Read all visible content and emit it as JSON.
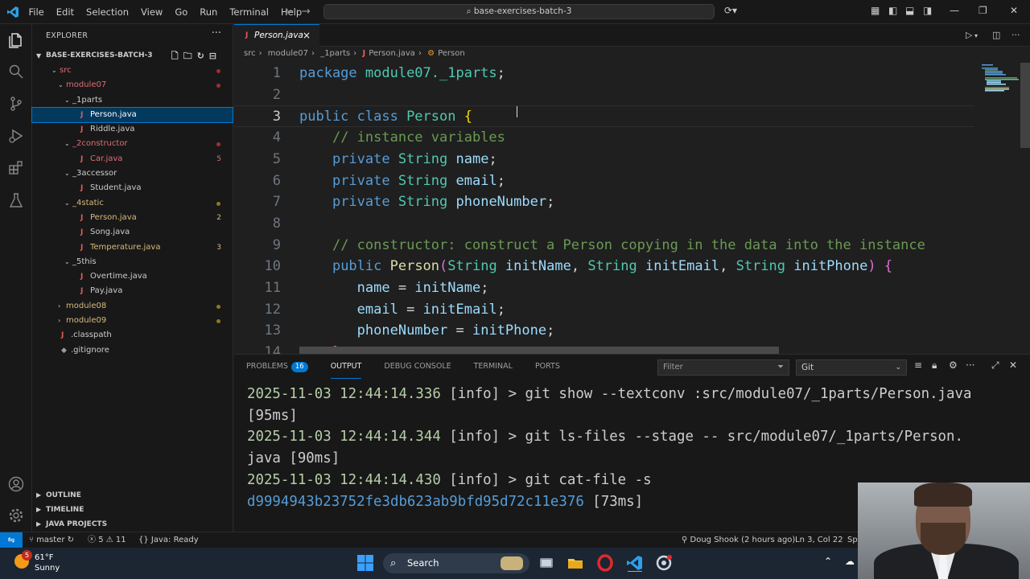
{
  "titlebar": {
    "menu": [
      "File",
      "Edit",
      "Selection",
      "View",
      "Go",
      "Run",
      "Terminal",
      "Help"
    ],
    "command_center": "base-exercises-batch-3"
  },
  "explorer": {
    "title": "EXPLORER",
    "root": "BASE-EXERCISES-BATCH-3",
    "tree": [
      {
        "label": "src",
        "kind": "folder",
        "open": true,
        "depth": 0,
        "color": "#e06c75",
        "dot": "#a03030"
      },
      {
        "label": "module07",
        "kind": "folder",
        "open": true,
        "depth": 1,
        "color": "#e06c75",
        "dot": "#a03030"
      },
      {
        "label": "_1parts",
        "kind": "folder",
        "open": true,
        "depth": 2,
        "color": "#cccccc"
      },
      {
        "label": "Person.java",
        "kind": "file",
        "depth": 3,
        "color": "#ffffff",
        "selected": true
      },
      {
        "label": "Riddle.java",
        "kind": "file",
        "depth": 3,
        "color": "#cccccc"
      },
      {
        "label": "_2constructor",
        "kind": "folder",
        "open": true,
        "depth": 2,
        "color": "#e06c75",
        "dot": "#a03030"
      },
      {
        "label": "Car.java",
        "kind": "file",
        "depth": 3,
        "color": "#e06c75",
        "badge": "5",
        "badge_color": "#e06c75"
      },
      {
        "label": "_3accessor",
        "kind": "folder",
        "open": true,
        "depth": 2,
        "color": "#cccccc"
      },
      {
        "label": "Student.java",
        "kind": "file",
        "depth": 3,
        "color": "#cccccc"
      },
      {
        "label": "_4static",
        "kind": "folder",
        "open": true,
        "depth": 2,
        "color": "#d7ba7d",
        "dot": "#8a7a20"
      },
      {
        "label": "Person.java",
        "kind": "file",
        "depth": 3,
        "color": "#d7ba7d",
        "badge": "2",
        "badge_color": "#d7ba7d"
      },
      {
        "label": "Song.java",
        "kind": "file",
        "depth": 3,
        "color": "#cccccc"
      },
      {
        "label": "Temperature.java",
        "kind": "file",
        "depth": 3,
        "color": "#d7ba7d",
        "badge": "3",
        "badge_color": "#d7ba7d"
      },
      {
        "label": "_5this",
        "kind": "folder",
        "open": true,
        "depth": 2,
        "color": "#cccccc"
      },
      {
        "label": "Overtime.java",
        "kind": "file",
        "depth": 3,
        "color": "#cccccc"
      },
      {
        "label": "Pay.java",
        "kind": "file",
        "depth": 3,
        "color": "#cccccc"
      },
      {
        "label": "module08",
        "kind": "folder",
        "open": false,
        "depth": 1,
        "color": "#d7ba7d",
        "dot": "#8a7a20"
      },
      {
        "label": "module09",
        "kind": "folder",
        "open": false,
        "depth": 1,
        "color": "#d7ba7d",
        "dot": "#8a7a20"
      },
      {
        "label": ".classpath",
        "kind": "file",
        "depth": 0,
        "color": "#cccccc"
      },
      {
        "label": ".gitignore",
        "kind": "gitignore",
        "depth": 0,
        "color": "#cccccc"
      }
    ],
    "sections": [
      "OUTLINE",
      "TIMELINE",
      "JAVA PROJECTS"
    ]
  },
  "editor": {
    "tab_label": "Person.java",
    "breadcrumb": [
      "src",
      "module07",
      "_1parts",
      "Person.java",
      "Person"
    ],
    "cursor_line": 3,
    "lines": [
      {
        "n": "1",
        "toks": [
          [
            "kw",
            "package "
          ],
          [
            "ty",
            "module07._1parts"
          ],
          [
            "pn",
            ";"
          ]
        ]
      },
      {
        "n": "2",
        "toks": []
      },
      {
        "n": "3",
        "toks": [
          [
            "kw",
            "public class "
          ],
          [
            "ty",
            "Person "
          ],
          [
            "br",
            "{"
          ]
        ]
      },
      {
        "n": "4",
        "toks": [
          [
            "pn",
            "    "
          ],
          [
            "cm",
            "// instance variables"
          ]
        ]
      },
      {
        "n": "5",
        "toks": [
          [
            "pn",
            "    "
          ],
          [
            "kw",
            "private "
          ],
          [
            "ty",
            "String "
          ],
          [
            "vr",
            "name"
          ],
          [
            "pn",
            ";"
          ]
        ]
      },
      {
        "n": "6",
        "toks": [
          [
            "pn",
            "    "
          ],
          [
            "kw",
            "private "
          ],
          [
            "ty",
            "String "
          ],
          [
            "vr",
            "email"
          ],
          [
            "pn",
            ";"
          ]
        ]
      },
      {
        "n": "7",
        "toks": [
          [
            "pn",
            "    "
          ],
          [
            "kw",
            "private "
          ],
          [
            "ty",
            "String "
          ],
          [
            "vr",
            "phoneNumber"
          ],
          [
            "pn",
            ";"
          ]
        ]
      },
      {
        "n": "8",
        "toks": []
      },
      {
        "n": "9",
        "toks": [
          [
            "pn",
            "    "
          ],
          [
            "cm",
            "// constructor: construct a Person copying in the data into the instance"
          ]
        ]
      },
      {
        "n": "10",
        "toks": [
          [
            "pn",
            "    "
          ],
          [
            "kw",
            "public "
          ],
          [
            "fn",
            "Person"
          ],
          [
            "br2",
            "("
          ],
          [
            "ty",
            "String "
          ],
          [
            "vr",
            "initName"
          ],
          [
            "pn",
            ", "
          ],
          [
            "ty",
            "String "
          ],
          [
            "vr",
            "initEmail"
          ],
          [
            "pn",
            ", "
          ],
          [
            "ty",
            "String "
          ],
          [
            "vr",
            "initPhone"
          ],
          [
            "br2",
            ")"
          ],
          [
            "pn",
            " "
          ],
          [
            "br2",
            "{"
          ]
        ]
      },
      {
        "n": "11",
        "toks": [
          [
            "pn",
            "       "
          ],
          [
            "vr",
            "name"
          ],
          [
            "pn",
            " = "
          ],
          [
            "vr",
            "initName"
          ],
          [
            "pn",
            ";"
          ]
        ]
      },
      {
        "n": "12",
        "toks": [
          [
            "pn",
            "       "
          ],
          [
            "vr",
            "email"
          ],
          [
            "pn",
            " = "
          ],
          [
            "vr",
            "initEmail"
          ],
          [
            "pn",
            ";"
          ]
        ]
      },
      {
        "n": "13",
        "toks": [
          [
            "pn",
            "       "
          ],
          [
            "vr",
            "phoneNumber"
          ],
          [
            "pn",
            " = "
          ],
          [
            "vr",
            "initPhone"
          ],
          [
            "pn",
            ";"
          ]
        ]
      },
      {
        "n": "14",
        "toks": [
          [
            "pn",
            "    "
          ],
          [
            "br2",
            "}"
          ]
        ]
      }
    ]
  },
  "panel": {
    "tabs": [
      "PROBLEMS",
      "OUTPUT",
      "DEBUG CONSOLE",
      "TERMINAL",
      "PORTS"
    ],
    "problems_count": "16",
    "active_tab": "OUTPUT",
    "filter_placeholder": "Filter",
    "channel": "Git",
    "output_lines": [
      [
        [
          "ts",
          "2025-11-03 12:44:14.336"
        ],
        [
          "tx",
          " [info] > git show --textconv :src/module07/_1parts/Person.java"
        ]
      ],
      [
        [
          "tx",
          "[95ms]"
        ]
      ],
      [
        [
          "ts",
          "2025-11-03 12:44:14.344"
        ],
        [
          "tx",
          " [info] > git ls-files --stage -- src/module07/_1parts/Person."
        ]
      ],
      [
        [
          "tx",
          "java [90ms]"
        ]
      ],
      [
        [
          "ts",
          "2025-11-03 12:44:14.430"
        ],
        [
          "tx",
          " [info] > git cat-file -s"
        ]
      ],
      [
        [
          "hx",
          "d9994943b23752fe3db623ab9bfd95d72c11e376"
        ],
        [
          "tx",
          " [73ms]"
        ]
      ]
    ]
  },
  "statusbar": {
    "branch": "master",
    "errors": "5",
    "warnings": "11",
    "java_status": "Java: Ready",
    "blame": "Doug Shook (2 hours ago)",
    "position": "Ln 3, Col 22",
    "spaces": "Spa"
  },
  "taskbar": {
    "weather_badge": "5",
    "temperature": "61°F",
    "condition": "Sunny",
    "search_label": "Search"
  }
}
